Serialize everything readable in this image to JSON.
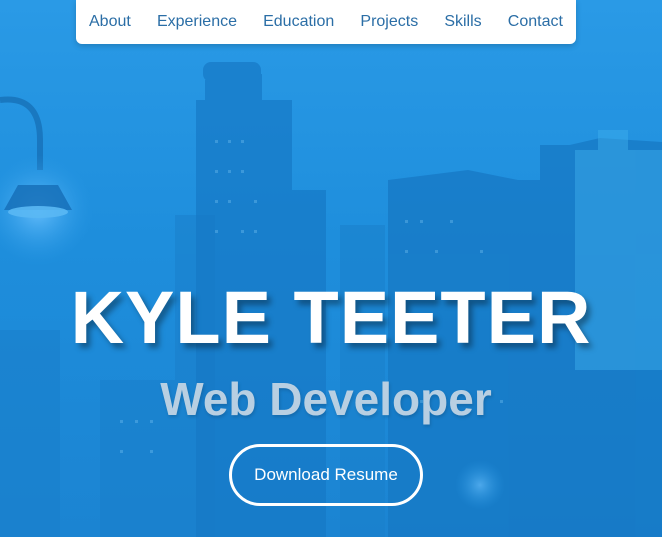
{
  "nav": {
    "items": [
      {
        "label": "About"
      },
      {
        "label": "Experience"
      },
      {
        "label": "Education"
      },
      {
        "label": "Projects"
      },
      {
        "label": "Skills"
      },
      {
        "label": "Contact"
      }
    ]
  },
  "hero": {
    "name": "KYLE TEETER",
    "role": "Web Developer",
    "cta_label": "Download Resume"
  },
  "colors": {
    "hero_background": "#1f8fdc",
    "nav_background": "#ffffff",
    "nav_link": "#2b6ea6",
    "title_text": "#ffffff",
    "subtitle_text": "#b8cfe2"
  }
}
